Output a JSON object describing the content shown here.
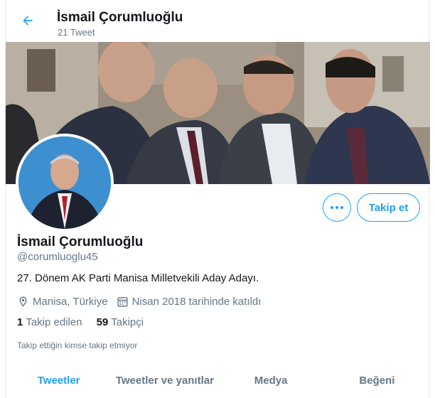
{
  "header": {
    "name": "İsmail Çorumluoğlu",
    "tweet_count": "21 Tweet"
  },
  "profile": {
    "name": "İsmail Çorumluoğlu",
    "handle": "@corumluoglu45",
    "bio": "27. Dönem AK Parti Manisa Milletvekili Aday Adayı.",
    "location": "Manisa, Türkiye",
    "joined": "Nisan 2018 tarihinde katıldı",
    "following_count": "1",
    "following_label": "Takip edilen",
    "followers_count": "59",
    "followers_label": "Takipçi",
    "followed_note": "Takip ettiğin kimse takip etmiyor"
  },
  "actions": {
    "more_icon": "more-horizontal-icon",
    "follow_label": "Takip et"
  },
  "tabs": [
    {
      "label": "Tweetler",
      "active": true
    },
    {
      "label": "Tweetler ve yanıtlar",
      "active": false
    },
    {
      "label": "Medya",
      "active": false
    },
    {
      "label": "Beğeni",
      "active": false
    }
  ],
  "icons": {
    "back": "arrow-left-icon",
    "location": "location-pin-icon",
    "calendar": "calendar-icon"
  },
  "colors": {
    "accent": "#1da1f2",
    "secondary_text": "#657786",
    "primary_text": "#14171a"
  }
}
